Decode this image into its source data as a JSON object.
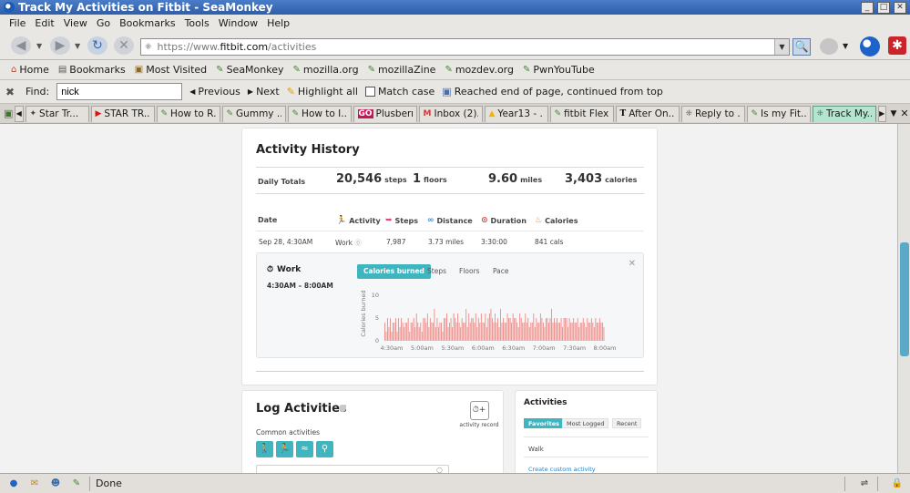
{
  "window": {
    "title": "Track My Activities on Fitbit - SeaMonkey",
    "controls": [
      "_",
      "□",
      "✕"
    ]
  },
  "menu": [
    "File",
    "Edit",
    "View",
    "Go",
    "Bookmarks",
    "Tools",
    "Window",
    "Help"
  ],
  "nav": {
    "url_scheme": "https://www.",
    "url_host": "fitbit.com",
    "url_path": "/activities"
  },
  "bookmarks": [
    {
      "label": "Home",
      "icon": "home-icon"
    },
    {
      "label": "Bookmarks",
      "icon": "bookmarks-icon"
    },
    {
      "label": "Most Visited",
      "icon": "folder-icon"
    },
    {
      "label": "SeaMonkey",
      "icon": "bookmark-icon"
    },
    {
      "label": "mozilla.org",
      "icon": "bookmark-icon"
    },
    {
      "label": "mozillaZine",
      "icon": "bookmark-icon"
    },
    {
      "label": "mozdev.org",
      "icon": "bookmark-icon"
    },
    {
      "label": "PwnYouTube",
      "icon": "bookmark-icon"
    }
  ],
  "find": {
    "label": "Find:",
    "query": "nick",
    "previous": "Previous",
    "next": "Next",
    "highlight": "Highlight all",
    "match_case": "Match case",
    "status": "Reached end of page, continued from top"
  },
  "tabs": [
    {
      "label": "Star Tr...",
      "icon": "star-trek-icon",
      "active": false
    },
    {
      "label": "STAR TR...",
      "icon": "youtube-icon",
      "active": false
    },
    {
      "label": "How to R...",
      "icon": "bookmark-icon",
      "active": false
    },
    {
      "label": "Gummy ...",
      "icon": "bookmark-icon",
      "active": false
    },
    {
      "label": "How to I...",
      "icon": "bookmark-icon",
      "active": false
    },
    {
      "label": "Plusberr...",
      "icon": "go-icon",
      "active": false
    },
    {
      "label": "Inbox (2)...",
      "icon": "gmail-icon",
      "active": false
    },
    {
      "label": "Year13 - ...",
      "icon": "drive-icon",
      "active": false
    },
    {
      "label": "fitbit Flex...",
      "icon": "bookmark-icon",
      "active": false
    },
    {
      "label": "After On...",
      "icon": "nyt-icon",
      "active": false
    },
    {
      "label": "Reply to ...",
      "icon": "page-icon",
      "active": false
    },
    {
      "label": "Is my Fit...",
      "icon": "bookmark-icon",
      "active": false
    },
    {
      "label": "Track My...",
      "icon": "fitbit-icon",
      "active": true
    }
  ],
  "activity_history": {
    "title": "Activity History",
    "daily_totals_label": "Daily Totals",
    "totals": {
      "steps": {
        "value": "20,546",
        "unit": "steps"
      },
      "floors": {
        "value": "1",
        "unit": "floors"
      },
      "miles": {
        "value": "9.60",
        "unit": "miles"
      },
      "calories": {
        "value": "3,403",
        "unit": "calories"
      }
    },
    "columns": {
      "date": "Date",
      "activity": "Activity",
      "steps": "Steps",
      "distance": "Distance",
      "duration": "Duration",
      "calories": "Calories"
    },
    "row": {
      "date": "Sep 28, 4:30AM",
      "activity": "Work",
      "steps": "7,987",
      "distance": "3.73 miles",
      "duration": "3:30:00",
      "calories": "841 cals"
    },
    "detail": {
      "title": "Work",
      "time": "4:30AM – 8:00AM",
      "tabs": [
        "Calories burned",
        "Steps",
        "Floors",
        "Pace"
      ]
    }
  },
  "chart_data": {
    "type": "bar",
    "ylabel": "Calories burned",
    "ylim": [
      0,
      12
    ],
    "yticks": [
      0,
      5,
      10
    ],
    "xticks": [
      "4:30am",
      "5:00am",
      "5:30am",
      "6:00am",
      "6:30am",
      "7:00am",
      "7:30am",
      "8:00am"
    ],
    "color": "#f08a86",
    "values": [
      4,
      2,
      5,
      3,
      5,
      2,
      4,
      4,
      5,
      2,
      5,
      3,
      5,
      4,
      3,
      4,
      4,
      5,
      2,
      4,
      4,
      5,
      3,
      6,
      4,
      3,
      4,
      2,
      5,
      5,
      4,
      6,
      3,
      5,
      4,
      4,
      7,
      3,
      5,
      3,
      4,
      4,
      2,
      5,
      5,
      6,
      3,
      4,
      5,
      3,
      6,
      5,
      4,
      6,
      4,
      3,
      5,
      4,
      4,
      7,
      3,
      6,
      4,
      5,
      5,
      4,
      6,
      3,
      5,
      4,
      6,
      4,
      4,
      6,
      3,
      5,
      6,
      7,
      5,
      4,
      6,
      4,
      5,
      3,
      7,
      4,
      5,
      4,
      4,
      6,
      5,
      5,
      4,
      6,
      5,
      5,
      4,
      3,
      6,
      5,
      4,
      4,
      6,
      4,
      5,
      3,
      4,
      4,
      6,
      3,
      5,
      4,
      4,
      6,
      5,
      4,
      3,
      5,
      5,
      4,
      5,
      7,
      4,
      5,
      4,
      5,
      4,
      4,
      5,
      3,
      5,
      5,
      5,
      3,
      5,
      4,
      4,
      5,
      4,
      4,
      5,
      3,
      4,
      4,
      5,
      4,
      3,
      5,
      4,
      4,
      5,
      4,
      3,
      5,
      4,
      4,
      5,
      4,
      4,
      3
    ]
  },
  "log_activities": {
    "title": "Log Activities",
    "activity_record": "activity record",
    "common_label": "Common activities",
    "common_icons": [
      "walk-icon",
      "run-icon",
      "swim-icon",
      "bike-icon"
    ]
  },
  "activities_panel": {
    "title": "Activities",
    "tabs": [
      "Favorites",
      "Most Logged",
      "Recent"
    ],
    "item": "Walk",
    "custom_link": "Create custom activity"
  },
  "status": {
    "text": "Done"
  },
  "colors": {
    "accent": "#3fb5c0",
    "bar": "#f08a86",
    "active_tab": "#b7e3d1",
    "scroll_thumb": "#5aa9c7"
  }
}
